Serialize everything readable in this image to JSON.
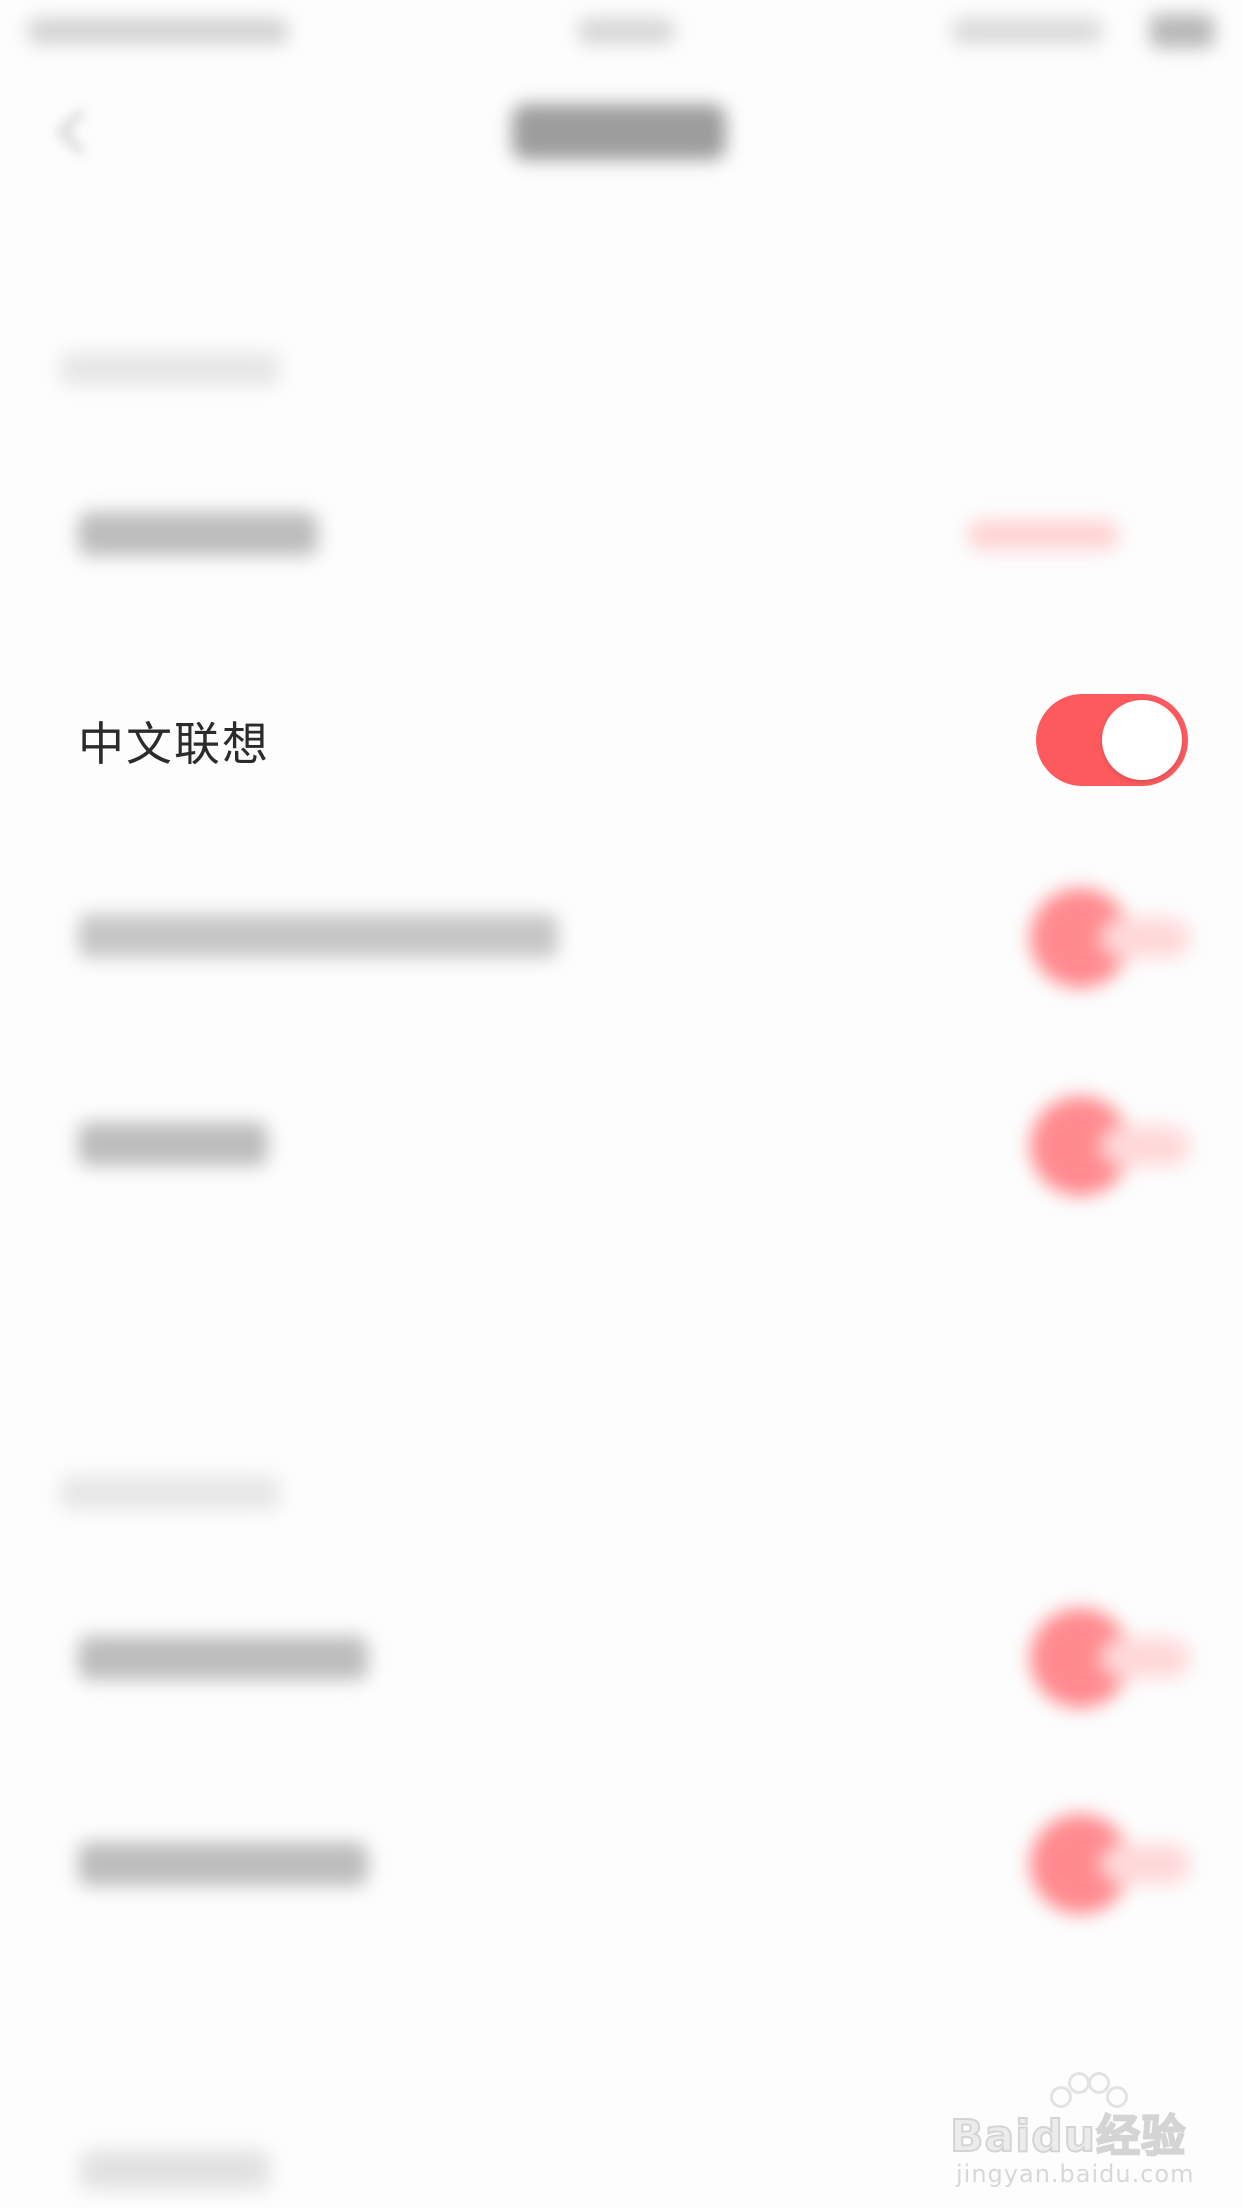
{
  "setting_focus": {
    "label": "中文联想",
    "toggle_state": "on",
    "accent_color": "#fd5a5e"
  },
  "watermark": {
    "brand": "Baidu经验",
    "url": "jingyan.baidu.com"
  },
  "icons": {
    "back": "chevron-left-icon",
    "watermark_paw": "baidu-paw-icon"
  }
}
